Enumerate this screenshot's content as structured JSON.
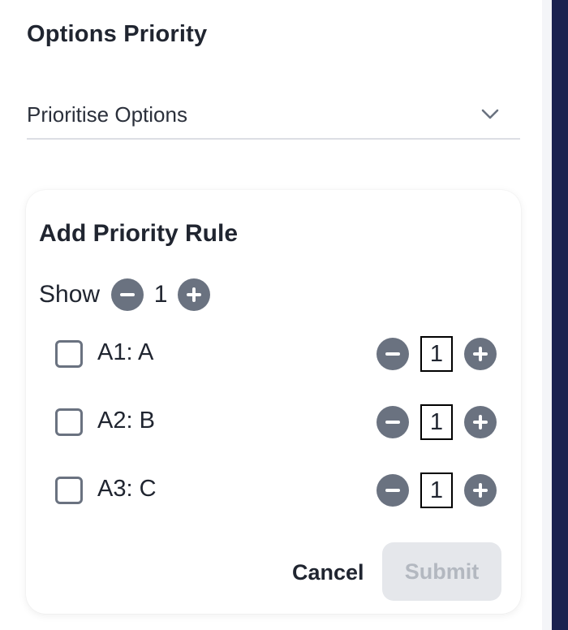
{
  "section": {
    "title": "Options Priority"
  },
  "select": {
    "value": "Prioritise Options",
    "icon": "chevron-down-icon"
  },
  "card": {
    "title": "Add Priority Rule",
    "show": {
      "label": "Show",
      "count": "1"
    },
    "options": [
      {
        "label": "A1: A",
        "quantity": "1",
        "checked": false
      },
      {
        "label": "A2: B",
        "quantity": "1",
        "checked": false
      },
      {
        "label": "A3: C",
        "quantity": "1",
        "checked": false
      }
    ],
    "cancel_label": "Cancel",
    "submit_label": "Submit",
    "submit_disabled": true
  },
  "colors": {
    "text": "#202530",
    "icon_gray": "#6a7280",
    "submit_bg_disabled": "#e5e7eb",
    "submit_text_disabled": "#b3b8c0",
    "side_bar": "#1c2350"
  }
}
